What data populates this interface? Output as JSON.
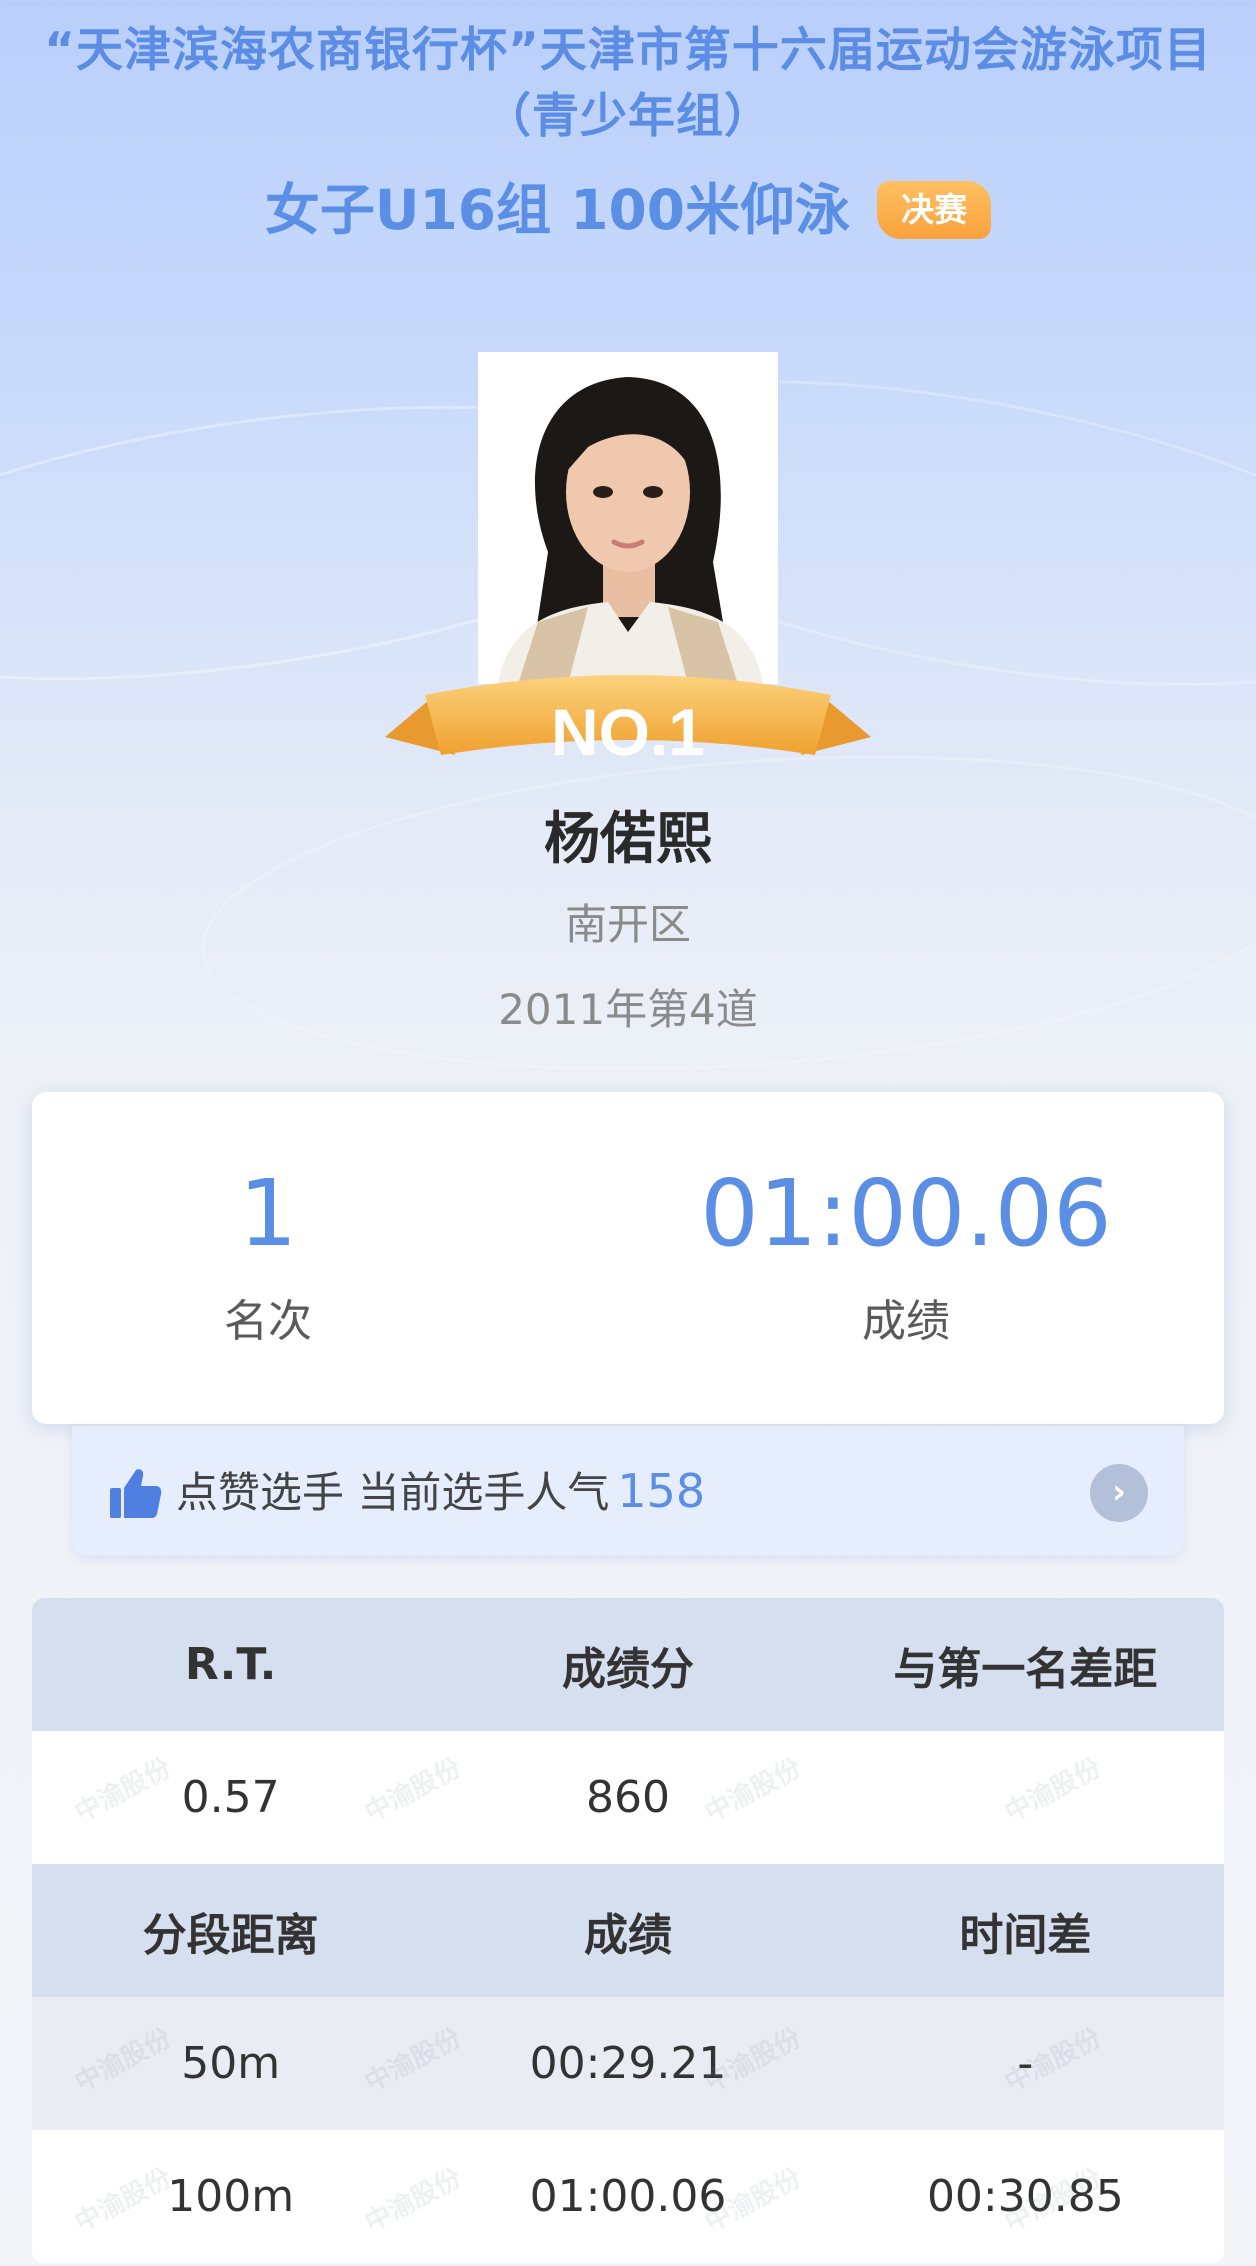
{
  "event": {
    "title_line1": "“天津滨海农商银行杯”天津市第十六届运动会游泳项目",
    "title_line2": "（青少年组）",
    "category": "女子U16组 100米仰泳",
    "stage_badge": "决赛"
  },
  "athlete": {
    "rank_ribbon": "NO.1",
    "name": "杨偌熙",
    "team": "南开区",
    "meta": "2011年第4道"
  },
  "result": {
    "rank_value": "1",
    "rank_label": "名次",
    "time_value": "01:00.06",
    "time_label": "成绩"
  },
  "likes": {
    "label": "点赞选手 当前选手人气",
    "count": "158"
  },
  "summary_table": {
    "headers": [
      "R.T.",
      "成绩分",
      "与第一名差距"
    ],
    "row": [
      "0.57",
      "860",
      ""
    ]
  },
  "splits_table": {
    "headers": [
      "分段距离",
      "成绩",
      "时间差"
    ],
    "rows": [
      [
        "50m",
        "00:29.21",
        "-"
      ],
      [
        "100m",
        "01:00.06",
        "00:30.85"
      ]
    ]
  },
  "watermark_text": "中渝股份",
  "icons": {
    "like": "thumbs-up-icon",
    "detail": "chevron-right-icon"
  },
  "colors": {
    "accent_blue": "#5b8ee5",
    "badge_orange": "#f8a23c",
    "ribbon_gold": "#f5b544"
  }
}
